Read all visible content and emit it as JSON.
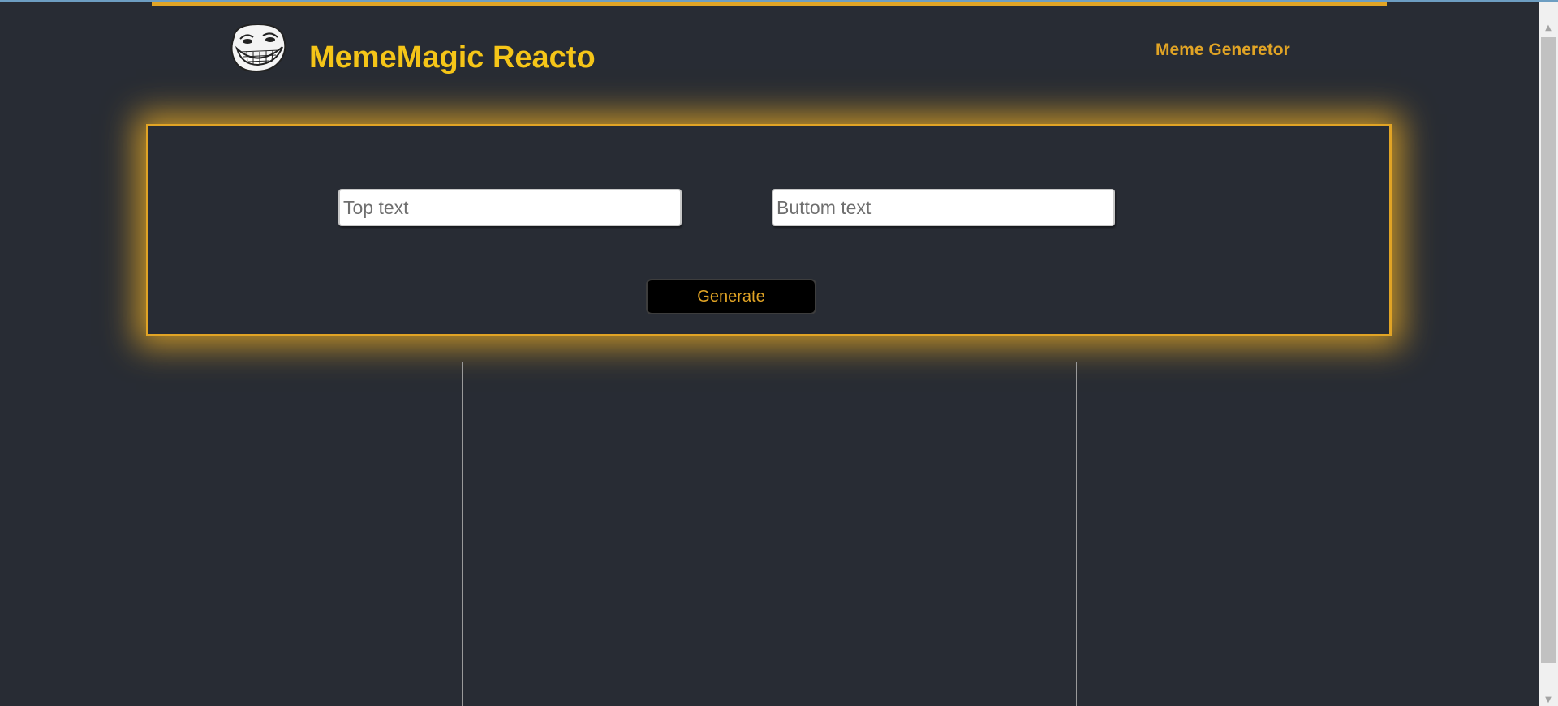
{
  "header": {
    "title": "MemeMagic Reacto",
    "nav_link": "Meme Generetor",
    "logo_icon": "troll-face-icon"
  },
  "form": {
    "top_text_placeholder": "Top text",
    "bottom_text_placeholder": "Buttom text",
    "top_text_value": "",
    "bottom_text_value": "",
    "generate_label": "Generate"
  },
  "colors": {
    "background": "#282c34",
    "accent": "#e1a425",
    "title": "#f5c518",
    "button_bg": "#000000"
  },
  "scrollbar": {
    "up_icon": "scroll-up-arrow-icon",
    "down_icon": "scroll-down-arrow-icon"
  }
}
